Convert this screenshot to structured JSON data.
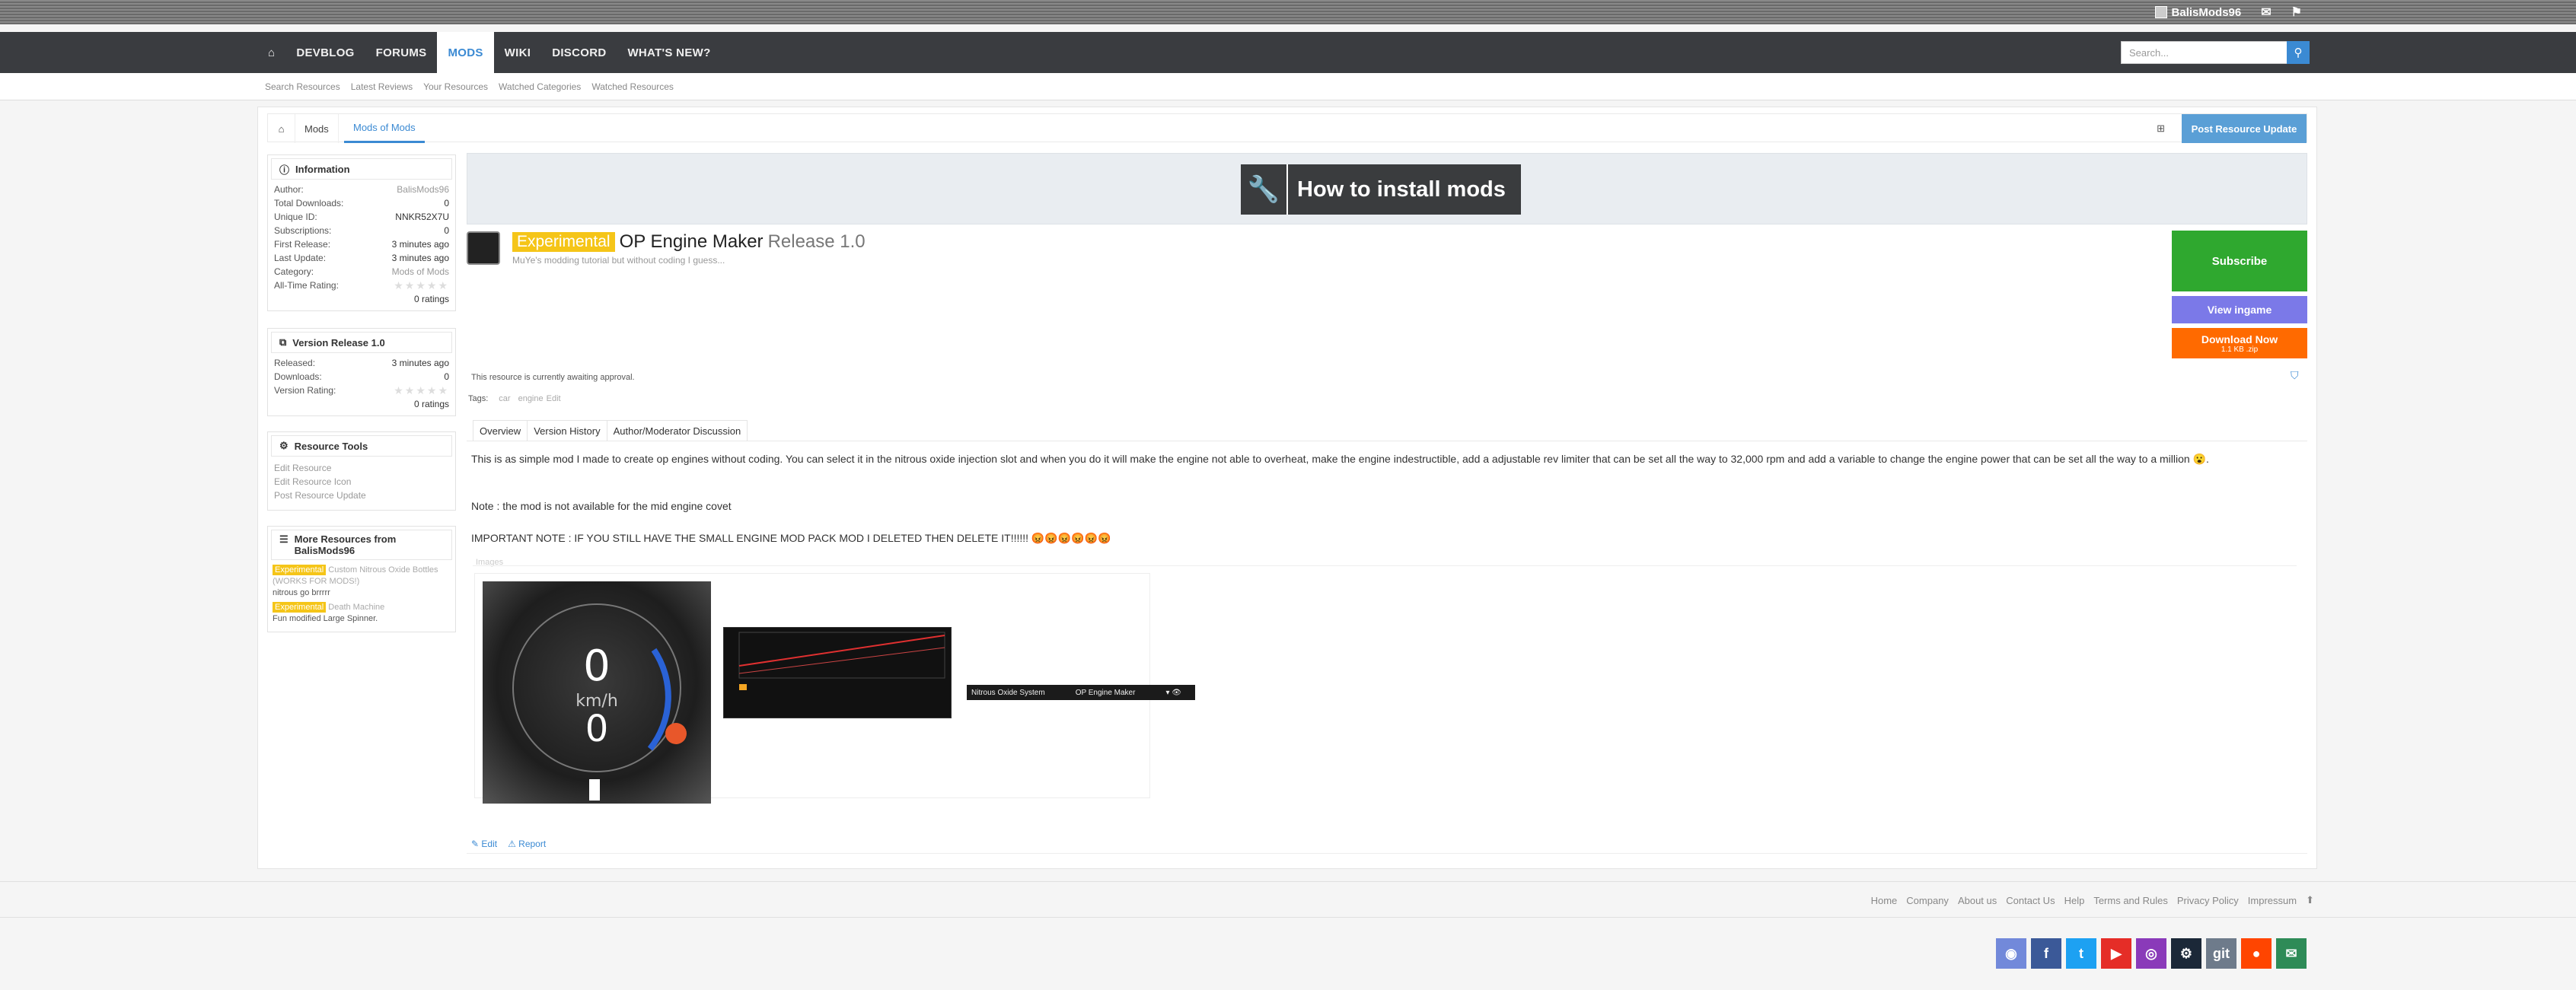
{
  "topbar": {
    "username": "BalisMods96"
  },
  "nav": {
    "items": [
      "DEVBLOG",
      "FORUMS",
      "MODS",
      "WIKI",
      "DISCORD",
      "WHAT'S NEW?"
    ],
    "active": "MODS"
  },
  "search": {
    "placeholder": "Search..."
  },
  "subnav": {
    "items": [
      "Search Resources",
      "Latest Reviews",
      "Your Resources",
      "Watched Categories",
      "Watched Resources"
    ]
  },
  "breadcrumb": {
    "items": [
      "Mods",
      "Mods of Mods"
    ]
  },
  "post_update_label": "Post Resource Update",
  "information": {
    "heading": "Information",
    "rows": [
      {
        "k": "Author:",
        "v": "BalisMods96"
      },
      {
        "k": "Total Downloads:",
        "v": "0"
      },
      {
        "k": "Unique ID:",
        "v": "NNKR52X7U"
      },
      {
        "k": "Subscriptions:",
        "v": "0"
      },
      {
        "k": "First Release:",
        "v": "3 minutes ago"
      },
      {
        "k": "Last Update:",
        "v": "3 minutes ago"
      },
      {
        "k": "Category:",
        "v": "Mods of Mods"
      },
      {
        "k": "All-Time Rating:",
        "v": "0 ratings"
      }
    ]
  },
  "version": {
    "heading": "Version Release 1.0",
    "rows": [
      {
        "k": "Released:",
        "v": "3 minutes ago"
      },
      {
        "k": "Downloads:",
        "v": "0"
      },
      {
        "k": "Version Rating:",
        "v": "0 ratings"
      }
    ]
  },
  "tools": {
    "heading": "Resource Tools",
    "links": [
      "Edit Resource",
      "Edit Resource Icon",
      "Post Resource Update"
    ]
  },
  "more": {
    "heading": "More Resources from BalisMods96",
    "items": [
      {
        "badge": "Experimental",
        "title": "Custom Nitrous Oxide Bottles (WORKS FOR MODS!)",
        "sub": "nitrous go brrrrr"
      },
      {
        "badge": "Experimental",
        "title": "Death Machine",
        "sub": "Fun modified Large Spinner."
      }
    ]
  },
  "banner": {
    "label": "How to install mods"
  },
  "resource": {
    "badge": "Experimental",
    "title": "OP Engine Maker",
    "release": "Release 1.0",
    "tagline": "MuYe's modding tutorial but without coding I guess..."
  },
  "buttons": {
    "subscribe": "Subscribe",
    "view_ingame": "View ingame",
    "download": "Download Now",
    "download_sub": "1.1 KB .zip"
  },
  "await_text": "This resource is currently awaiting approval.",
  "tags": {
    "label": "Tags:",
    "items": [
      "car",
      "engine"
    ],
    "edit": "Edit"
  },
  "tabs": [
    "Overview",
    "Version History",
    "Author/Moderator Discussion"
  ],
  "description": {
    "p1": "This is as simple mod I made to create op engines without coding. You can select it in the nitrous oxide injection slot and when you do it will make the engine not able to overheat, make the engine indestructible, add a adjustable rev limiter that can be set all the way to 32,000 rpm and add a variable to change the engine power that can be set all the way to a million 😮.",
    "p2": "Note : the mod is not available for the mid engine covet",
    "p3": "IMPORTANT NOTE : IF YOU STILL HAVE THE SMALL ENGINE MOD PACK MOD I DELETED THEN DELETE IT!!!!!! 😡😡😡😡😡😡"
  },
  "images_label": "Images",
  "thumb3": {
    "left": "Nitrous Oxide System",
    "right": "OP Engine Maker"
  },
  "actions": {
    "edit": "Edit",
    "report": "Report"
  },
  "footer": {
    "links": [
      "Home",
      "Company",
      "About us",
      "Contact Us",
      "Help",
      "Terms and Rules",
      "Privacy Policy",
      "Impressum"
    ]
  },
  "socials": [
    {
      "name": "discord-icon",
      "color": "#7289da",
      "g": "◉"
    },
    {
      "name": "facebook-icon",
      "color": "#3b5998",
      "g": "f"
    },
    {
      "name": "twitter-icon",
      "color": "#1da1f2",
      "g": "t"
    },
    {
      "name": "youtube-icon",
      "color": "#e52d27",
      "g": "▶"
    },
    {
      "name": "instagram-icon",
      "color": "#8a3ab9",
      "g": "◎"
    },
    {
      "name": "steam-icon",
      "color": "#1b2838",
      "g": "⚙"
    },
    {
      "name": "git-icon",
      "color": "#6e7b8b",
      "g": "git"
    },
    {
      "name": "reddit-icon",
      "color": "#ff4500",
      "g": "●"
    },
    {
      "name": "email-icon",
      "color": "#2e8b57",
      "g": "✉"
    }
  ]
}
